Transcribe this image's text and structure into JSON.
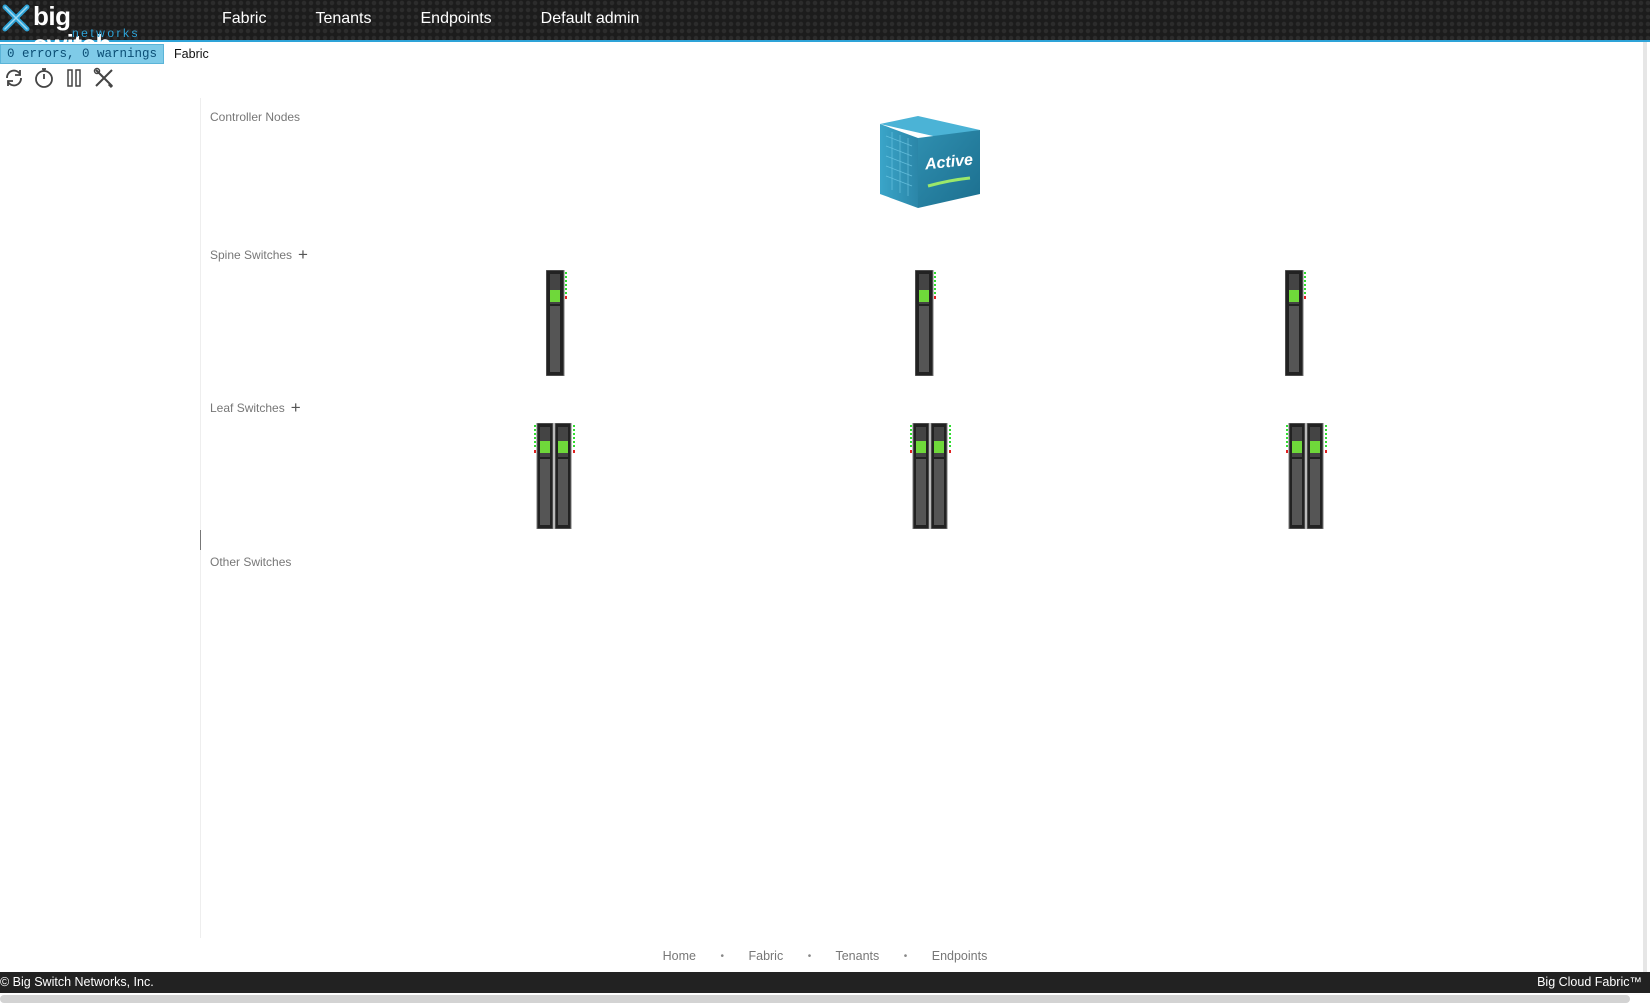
{
  "header": {
    "logo_text": "big switch",
    "logo_sub": "networks",
    "nav": [
      {
        "label": "Fabric"
      },
      {
        "label": "Tenants"
      },
      {
        "label": "Endpoints"
      },
      {
        "label": "Default admin"
      }
    ],
    "accent_color": "#2ea3d8"
  },
  "status": {
    "badge": "0 errors, 0 warnings",
    "breadcrumb": "Fabric"
  },
  "toolbar": {
    "icons": [
      "refresh-icon",
      "timer-icon",
      "pause-icon",
      "tools-icon"
    ]
  },
  "sections": {
    "controller": {
      "label": "Controller Nodes",
      "node_state": "Active"
    },
    "spine": {
      "label": "Spine Switches",
      "add": "+"
    },
    "leaf": {
      "label": "Leaf Switches",
      "add": "+"
    },
    "other": {
      "label": "Other Switches"
    }
  },
  "footer": {
    "links": [
      "Home",
      "Fabric",
      "Tenants",
      "Endpoints"
    ],
    "separator": "•",
    "copyright": "© Big Switch Networks, Inc.",
    "product": "Big Cloud Fabric™"
  }
}
